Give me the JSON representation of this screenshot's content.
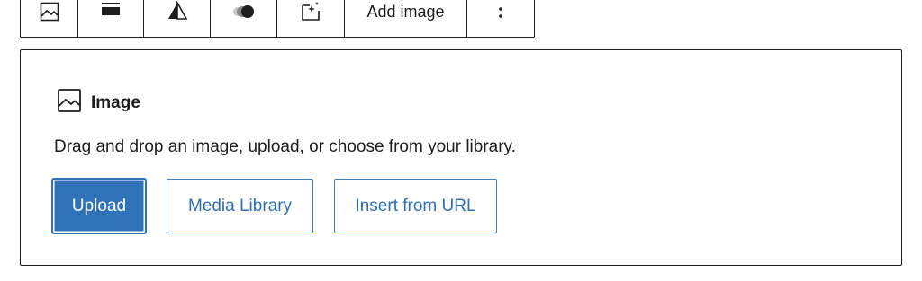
{
  "toolbar": {
    "items": [
      {
        "icon": "image-icon"
      },
      {
        "icon": "align-icon"
      },
      {
        "icon": "flip-icon"
      },
      {
        "icon": "duotone-icon"
      },
      {
        "icon": "ai-image-icon"
      },
      {
        "label": "Add image"
      },
      {
        "icon": "more-vertical-icon"
      }
    ]
  },
  "block": {
    "title": "Image",
    "instructions": "Drag and drop an image, upload, or choose from your library.",
    "upload_label": "Upload",
    "media_library_label": "Media Library",
    "insert_url_label": "Insert from URL"
  },
  "colors": {
    "primary": "#3072b7",
    "text": "#1e1e1e",
    "border": "#1e1e1e"
  }
}
